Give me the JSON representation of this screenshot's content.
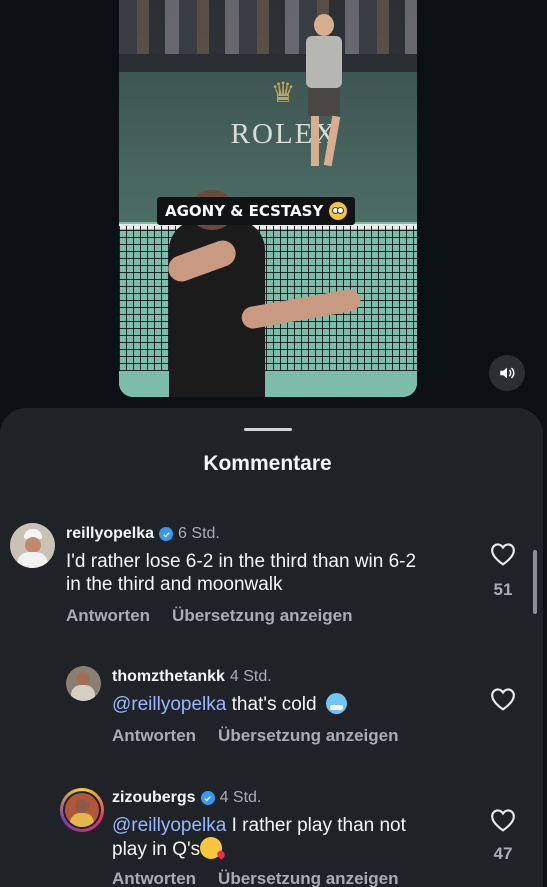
{
  "video": {
    "caption": "AGONY & ECSTASY",
    "caption_emoji": "flushed-face-emoji",
    "brand_text": "ROLEX",
    "sound_icon": "speaker-icon"
  },
  "sheet": {
    "title": "Kommentare"
  },
  "comments": [
    {
      "username": "reillyopelka",
      "verified": true,
      "time": "6 Std.",
      "text_line1": "I'd rather lose 6-2 in the third than win 6-2",
      "text_line2": "in the third and moonwalk",
      "reply_label": "Antworten",
      "translate_label": "Übersetzung anzeigen",
      "likes": "51"
    },
    {
      "username": "thomzthetankk",
      "verified": false,
      "time": "4 Std.",
      "mention": "@reillyopelka",
      "text": "that's cold",
      "reply_label": "Antworten",
      "translate_label": "Übersetzung anzeigen",
      "likes": ""
    },
    {
      "username": "zizoubergs",
      "verified": true,
      "time": "4 Std.",
      "mention": "@reillyopelka",
      "text_line1": "I rather play than not",
      "text_line2": "play in Q's",
      "reply_label": "Antworten",
      "translate_label": "Übersetzung anzeigen",
      "likes": "47"
    }
  ],
  "colors": {
    "background": "#0b1014",
    "sheet": "#1f2328",
    "mention": "#9ab6ff",
    "verified": "#3897f0",
    "muted_text": "#a8adb3"
  }
}
